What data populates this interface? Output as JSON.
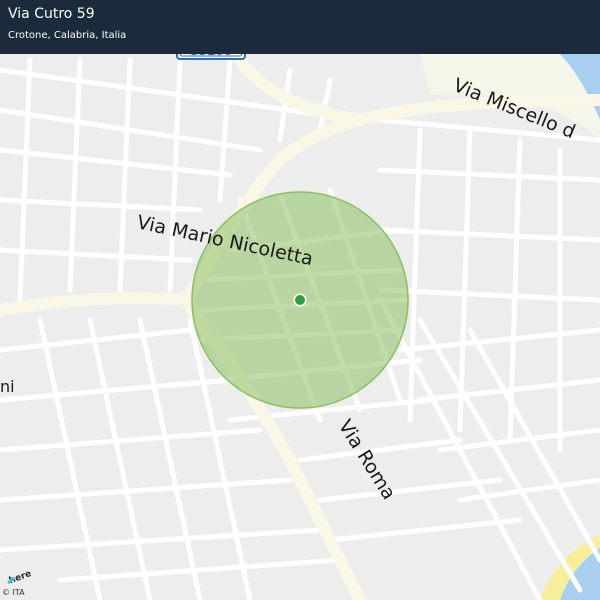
{
  "header": {
    "title": "Via Cutro 59",
    "subtitle": "Crotone, Calabria, Italia"
  },
  "map": {
    "labels": {
      "via_mario_nicoletta": "Via  Mario  Nicoletta",
      "via_miscello": "Via   Miscello  d",
      "via_roma": "Via  Roma",
      "partial_left": "ni"
    },
    "road_shield": "SS106",
    "marker": {
      "color": "#2f9e3f"
    },
    "accuracy_circle": {
      "color": "#8cbf62"
    },
    "sea_color": "#a8cfee",
    "beach_color": "#f7ee9c"
  },
  "footer": {
    "logo_text": "here",
    "copyright": "© ITA"
  }
}
